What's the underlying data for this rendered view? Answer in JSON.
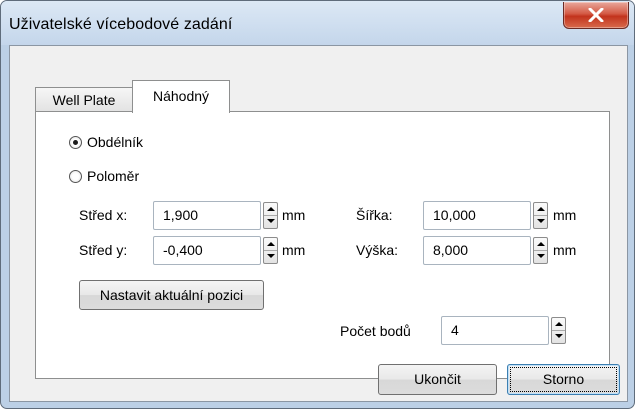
{
  "window": {
    "title": "Uživatelské vícebodové zadání"
  },
  "tabs": [
    {
      "label": "Well Plate",
      "active": false
    },
    {
      "label": "Náhodný",
      "active": true
    }
  ],
  "shape": {
    "rect_label": "Obdélník",
    "radius_label": "Poloměr",
    "selected": "Obdélník"
  },
  "fields": {
    "center_x": {
      "label": "Střed x:",
      "value": "1,900",
      "unit": "mm"
    },
    "center_y": {
      "label": "Střed y:",
      "value": "-0,400",
      "unit": "mm"
    },
    "width": {
      "label": "Šířka:",
      "value": "10,000",
      "unit": "mm"
    },
    "height": {
      "label": "Výška:",
      "value": "8,000",
      "unit": "mm"
    },
    "count": {
      "label": "Počet bodů",
      "value": "4"
    }
  },
  "buttons": {
    "set_position": "Nastavit aktuální pozici",
    "finish": "Ukončit",
    "cancel": "Storno"
  },
  "colors": {
    "window_frame": "#bcd0e6",
    "close_button": "#c94a36",
    "panel_bg": "#f0f0f0"
  }
}
